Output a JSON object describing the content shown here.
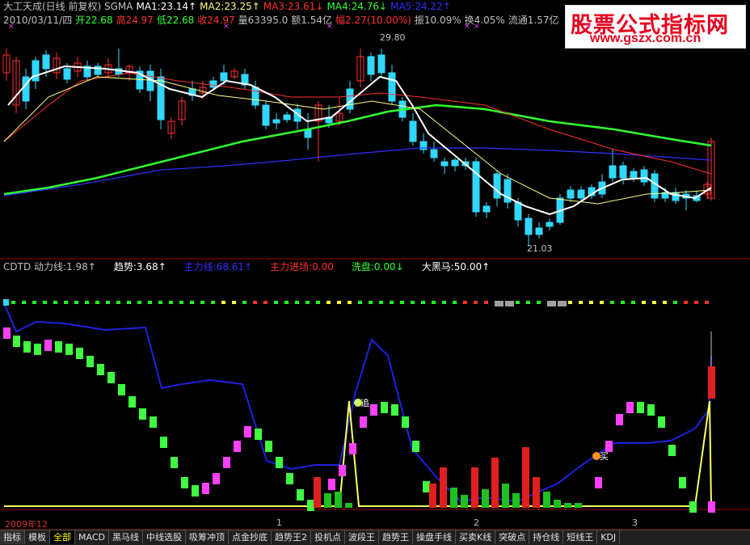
{
  "header": {
    "line1": [
      {
        "text": "大工天成(日线 前复权) SGMA",
        "color": "#c0c0c0"
      },
      {
        "text": "MA1:23.14↑",
        "color": "#ffffff"
      },
      {
        "text": "MA2:23.25↑",
        "color": "#ffff80"
      },
      {
        "text": "MA3:23.61↓",
        "color": "#ff3030"
      },
      {
        "text": "MA4:24.76↓",
        "color": "#30ff30"
      },
      {
        "text": "MA5:24.22↑",
        "color": "#3030ff"
      }
    ],
    "line2": [
      {
        "text": "2010/03/11/四",
        "color": "#c0c0c0"
      },
      {
        "text": "开22.68",
        "color": "#30ff30"
      },
      {
        "text": "高24.97",
        "color": "#ff3030"
      },
      {
        "text": "低22.68",
        "color": "#30ff30"
      },
      {
        "text": "收24.97",
        "color": "#ff3030"
      },
      {
        "text": "量63395.0",
        "color": "#c0c0c0"
      },
      {
        "text": "额1.54亿",
        "color": "#c0c0c0"
      },
      {
        "text": "幅2.27(10.00%)",
        "color": "#ff3030"
      },
      {
        "text": "振10.09%",
        "color": "#c0c0c0"
      },
      {
        "text": "换4.05%",
        "color": "#c0c0c0"
      },
      {
        "text": "流通1.57亿",
        "color": "#c0c0c0"
      }
    ]
  },
  "watermark": {
    "title": "股票公式指标网",
    "url": "www.gszx.com.cn"
  },
  "price_marks": {
    "high": "29.80",
    "low": "21.03"
  },
  "indicator": [
    {
      "text": "CDTD  动力线:1.98↑",
      "color": "#c0c0c0"
    },
    {
      "text": "趋势:3.68↑",
      "color": "#ffffff"
    },
    {
      "text": "主力线:68.61↑",
      "color": "#3030ff"
    },
    {
      "text": "主力进场:0.00",
      "color": "#ff3030"
    },
    {
      "text": "洗盘:0.00↓",
      "color": "#30ff30"
    },
    {
      "text": "大黑马:50.00↑",
      "color": "#ffffff"
    }
  ],
  "signals": {
    "buy1": "追",
    "buy2": "买"
  },
  "date_axis": {
    "start": "2009年12",
    "ticks": [
      "1",
      "2",
      "3"
    ]
  },
  "tabs": [
    "指标",
    "模板",
    "全部",
    "MACD",
    "黑马线",
    "中线选股",
    "吸筹冲顶",
    "点金抄底",
    "趋势王2",
    "投机点",
    "波段王",
    "趋势王",
    "操盘手线",
    "买卖K线",
    "突破点",
    "持仓线",
    "短线王",
    "KDJ"
  ],
  "active_tab": "全部",
  "colors": {
    "up": "#ff3030",
    "down": "#30d8ff",
    "ma1": "#ffffff",
    "ma2": "#ffff80",
    "ma3": "#ff3030",
    "ma4": "#30ff30",
    "ma5": "#3030ff"
  }
}
